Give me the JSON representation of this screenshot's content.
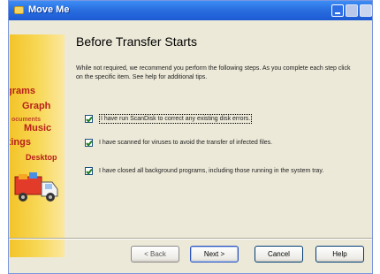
{
  "window": {
    "title": "Move Me"
  },
  "sidebar": {
    "words": [
      "grams",
      "Graph",
      "ocuments",
      "Music",
      "ttings",
      "Desktop"
    ]
  },
  "page": {
    "heading": "Before Transfer Starts",
    "intro": "While not required, we recommend you perform the following steps. As you complete each step click on the specific item. See help for additional tips."
  },
  "checklist": [
    {
      "label": "I have run ScanDisk to correct any existing disk errors.",
      "checked": true
    },
    {
      "label": "I have scanned for viruses to avoid the transfer of infected files.",
      "checked": true
    },
    {
      "label": "I have closed all background programs, including those running in the system tray.",
      "checked": true
    }
  ],
  "buttons": {
    "back": "< Back",
    "next": "Next >",
    "cancel": "Cancel",
    "help": "Help"
  },
  "colors": {
    "titlebar": "#2a6fe0",
    "sidebar": "#f3c428",
    "sidebar_text": "#b8201a",
    "dialog_bg": "#ece9d8"
  },
  "icons": {
    "app": "move-me-app-icon",
    "truck": "moving-truck-icon"
  }
}
